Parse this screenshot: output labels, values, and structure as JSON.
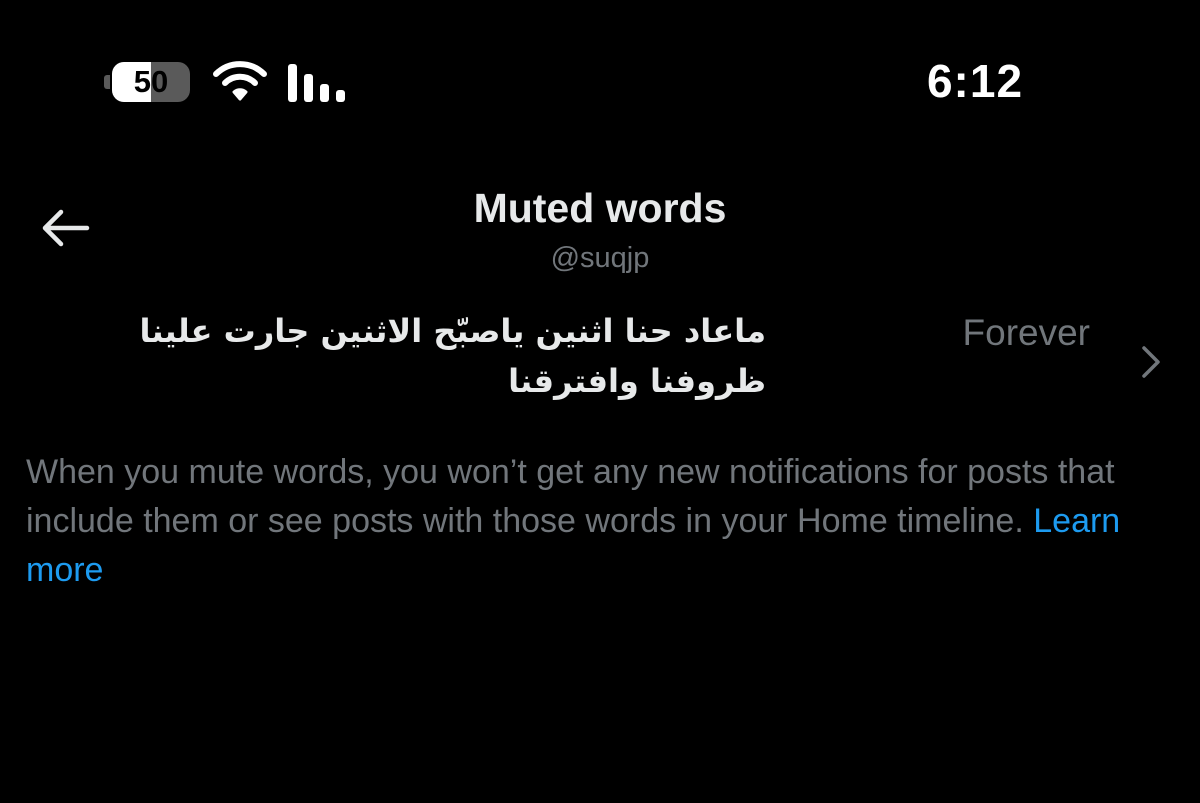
{
  "status_bar": {
    "battery_level": "50",
    "battery_fraction": 0.5,
    "time": "6:12",
    "icons": [
      "battery-icon",
      "wifi-icon",
      "cellular-signal-icon"
    ]
  },
  "header": {
    "back_icon": "arrow-left-icon",
    "title": "Muted words",
    "handle": "@suqjp"
  },
  "muted_words": [
    {
      "word": "ماعاد حنا اثنين ياصبّح الاثنين جارت علينا ظروفنا وافترقنا",
      "duration": "Forever",
      "icon": "chevron-right-icon"
    }
  ],
  "description": {
    "text": "When you mute words, you won’t get any new notifications for posts that include them or see posts with those words in your Home timeline.",
    "link_label": "Learn more"
  },
  "colors": {
    "background": "#000000",
    "primary_text": "#e7e9ea",
    "secondary_text": "#71767b",
    "link": "#1d9bf0"
  }
}
